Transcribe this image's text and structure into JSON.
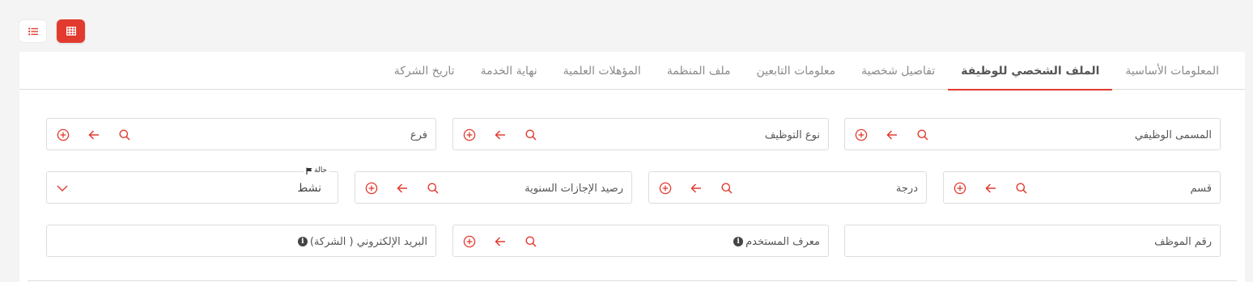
{
  "view_toggle": {
    "list_icon": "list-icon",
    "grid_icon": "grid-icon",
    "active": "grid"
  },
  "colors": {
    "accent": "#e23a2f",
    "border": "#dddddd"
  },
  "tabs": [
    {
      "label": "المعلومات الأساسية",
      "active": false
    },
    {
      "label": "الملف الشخصي للوظيفة",
      "active": true
    },
    {
      "label": "تفاصيل شخصية",
      "active": false
    },
    {
      "label": "معلومات التابعين",
      "active": false
    },
    {
      "label": "ملف المنظمة",
      "active": false
    },
    {
      "label": "المؤهلات العلمية",
      "active": false
    },
    {
      "label": "نهاية الخدمة",
      "active": false
    },
    {
      "label": "تاريخ الشركة",
      "active": false
    }
  ],
  "fields": {
    "job_title": "المسمى الوظيفي",
    "employment_type": "نوع التوظيف",
    "branch": "فرع",
    "department": "قسم",
    "grade": "درجة",
    "annual_leave_balance": "رصيد الإجازات السنوية",
    "status_label": "حالة",
    "status_value": "نشط",
    "employee_number": "رقم الموظف",
    "user_id": "معرف المستخدم",
    "company_email": "البريد الإلكتروني ( الشركة)"
  },
  "field_icons": [
    "add-circle-icon",
    "arrow-left-icon",
    "search-icon"
  ]
}
